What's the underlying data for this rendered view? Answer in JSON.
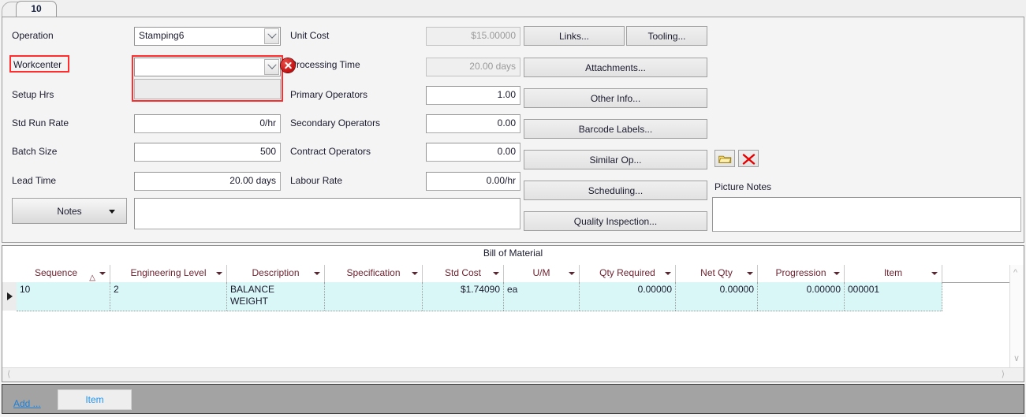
{
  "window": {
    "tab_label": "10"
  },
  "form": {
    "left_fields": [
      {
        "label": "Operation",
        "type": "combo",
        "value": "Stamping6"
      },
      {
        "label": "Workcenter",
        "type": "combo",
        "value": ""
      },
      {
        "label": "Setup Hrs",
        "type": "text",
        "value": ""
      },
      {
        "label": "Std Run Rate",
        "type": "text",
        "value": "0/hr"
      },
      {
        "label": "Batch Size",
        "type": "text",
        "value": "500"
      },
      {
        "label": "Lead Time",
        "type": "text",
        "value": "20.00 days"
      }
    ],
    "middle_fields": [
      {
        "label": "Unit Cost",
        "value": "$15.00000",
        "readonly": true
      },
      {
        "label": "Processing Time",
        "value": "20.00 days",
        "readonly": true
      },
      {
        "label": "Primary Operators",
        "value": "1.00",
        "readonly": false
      },
      {
        "label": "Secondary Operators",
        "value": "0.00",
        "readonly": false
      },
      {
        "label": "Contract Operators",
        "value": "0.00",
        "readonly": false
      },
      {
        "label": "Labour Rate",
        "value": "0.00/hr",
        "readonly": false
      }
    ],
    "buttons": {
      "links": "Links...",
      "tooling": "Tooling...",
      "attachments": "Attachments...",
      "other_info": "Other Info...",
      "barcode_labels": "Barcode Labels...",
      "similar_op": "Similar Op...",
      "scheduling": "Scheduling...",
      "quality_inspection": "Quality Inspection..."
    },
    "notes_button": "Notes",
    "notes_value": "",
    "picture_notes_label": "Picture Notes",
    "picture_notes_value": "",
    "validation": {
      "error_field": "Workcenter",
      "highlight_color": "#ff2d2d"
    }
  },
  "grid": {
    "title": "Bill of Material",
    "columns": [
      {
        "label": "Sequence",
        "sorted": true
      },
      {
        "label": "Engineering Level",
        "sorted": false
      },
      {
        "label": "Description",
        "sorted": false
      },
      {
        "label": "Specification",
        "sorted": false
      },
      {
        "label": "Std Cost",
        "sorted": false
      },
      {
        "label": "U/M",
        "sorted": false
      },
      {
        "label": "Qty Required",
        "sorted": false
      },
      {
        "label": "Net Qty",
        "sorted": false
      },
      {
        "label": "Progression",
        "sorted": false
      },
      {
        "label": "Item",
        "sorted": false
      }
    ],
    "rows": [
      {
        "sequence": "10",
        "engineering_level": "2",
        "description": "BALANCE\nWEIGHT",
        "specification": "",
        "std_cost": "$1.74090",
        "um": "ea",
        "qty_required": "0.00000",
        "net_qty": "0.00000",
        "progression": "0.00000",
        "item": "000001"
      }
    ]
  },
  "bottom": {
    "add_link": "Add ...",
    "item_tab": "Item"
  }
}
